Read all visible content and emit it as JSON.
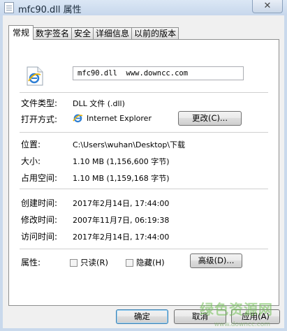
{
  "window": {
    "title": "mfc90.dll 属性",
    "close_symbol": "✕"
  },
  "tabs": [
    {
      "label": "常规",
      "active": true
    },
    {
      "label": "数字签名"
    },
    {
      "label": "安全"
    },
    {
      "label": "详细信息"
    },
    {
      "label": "以前的版本"
    }
  ],
  "general": {
    "file_name": "mfc90.dll  www.downcc.com",
    "file_type_label": "文件类型:",
    "file_type_value": "DLL 文件 (.dll)",
    "opens_with_label": "打开方式:",
    "opens_with_value": "Internet Explorer",
    "change_button": "更改(C)...",
    "location_label": "位置:",
    "location_value": "C:\\Users\\wuhan\\Desktop\\下载",
    "size_label": "大小:",
    "size_value": "1.10 MB (1,156,600 字节)",
    "size_on_disk_label": "占用空间:",
    "size_on_disk_value": "1.10 MB (1,159,168 字节)",
    "created_label": "创建时间:",
    "created_value": "2017年2月14日, 17:44:00",
    "modified_label": "修改时间:",
    "modified_value": "2007年11月7日, 06:19:38",
    "accessed_label": "访问时间:",
    "accessed_value": "2017年2月14日, 17:44:00",
    "attributes_label": "属性:",
    "readonly_label": "只读(R)",
    "hidden_label": "隐藏(H)",
    "advanced_button": "高级(D)..."
  },
  "footer": {
    "ok": "确定",
    "cancel": "取消",
    "apply": "应用(A)"
  },
  "watermark": {
    "text": "绿色资源网",
    "sub": "www.downcc.com"
  },
  "icons": {
    "file": "internet-explorer-icon",
    "app": "internet-explorer-icon",
    "close": "close-icon"
  },
  "colors": {
    "titlebar": "#c7d7ec",
    "default_button_border": "#3c7fb1",
    "watermark": "#6ebe50"
  }
}
